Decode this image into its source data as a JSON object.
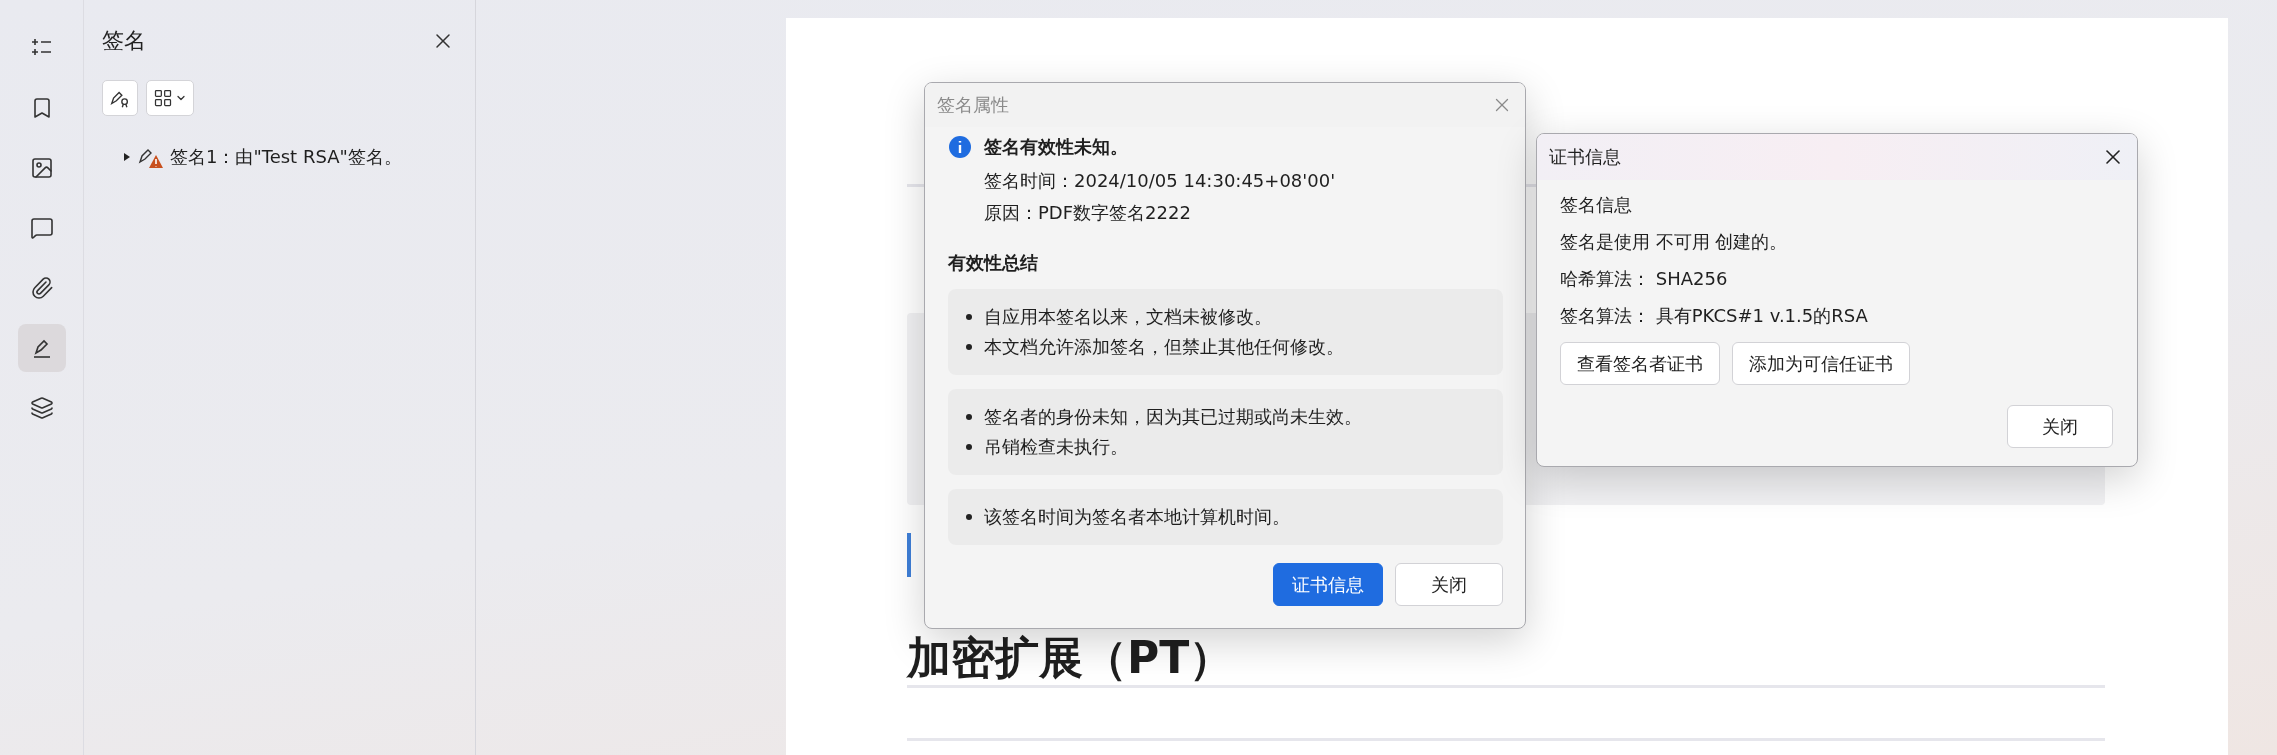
{
  "rail": {
    "items": [
      {
        "kind": "outline",
        "selected": false
      },
      {
        "kind": "bookmark",
        "selected": false
      },
      {
        "kind": "image",
        "selected": false
      },
      {
        "kind": "comment",
        "selected": false
      },
      {
        "kind": "attachment",
        "selected": false
      },
      {
        "kind": "signature",
        "selected": true
      },
      {
        "kind": "layers",
        "selected": false
      }
    ]
  },
  "panel": {
    "title": "签名",
    "tree": [
      {
        "label": "签名1：由\"Test RSA\"签名。",
        "expanded": false,
        "warning": true
      }
    ]
  },
  "document": {
    "section_heading": "加密扩展（PT）"
  },
  "signature_dialog": {
    "title": "签名属性",
    "status": "签名有效性未知。",
    "details": [
      "签名时间：2024/10/05 14:30:45+08'00'",
      "原因：PDF数字签名2222"
    ],
    "summary_title": "有效性总结",
    "summary_groups": [
      [
        "自应用本签名以来，文档未被修改。",
        "本文档允许添加签名，但禁止其他任何修改。"
      ],
      [
        "签名者的身份未知，因为其已过期或尚未生效。",
        "吊销检查未执行。"
      ],
      [
        "该签名时间为签名者本地计算机时间。"
      ]
    ],
    "buttons": [
      {
        "label": "证书信息",
        "primary": true
      },
      {
        "label": "关闭",
        "primary": false
      }
    ]
  },
  "certificate_dialog": {
    "title": "证书信息",
    "lines": [
      "签名信息",
      "签名是使用 不可用 创建的。",
      "哈希算法：  SHA256",
      "签名算法：  具有PKCS#1 v.1.5的RSA"
    ],
    "buttons": [
      "查看签名者证书",
      "添加为可信任证书"
    ],
    "close_button": "关闭"
  }
}
